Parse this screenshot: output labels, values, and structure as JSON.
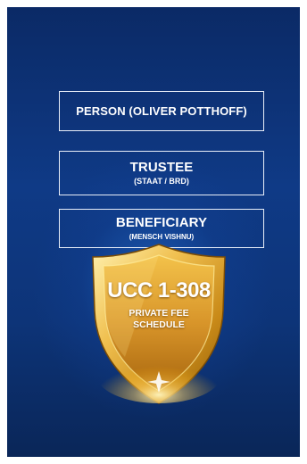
{
  "boxes": {
    "person": {
      "main": "PERSON (OLIVER POTTHOFF)"
    },
    "trustee": {
      "main": "TRUSTEE",
      "sub": "(STAAT / BRD)"
    },
    "beneficiary": {
      "main": "BENEFICIARY",
      "sub": "(MENSCH VISHNU)"
    }
  },
  "shield": {
    "title": "UCC 1-308",
    "line1": "PRIVATE FEE",
    "line2": "SCHEDULE"
  },
  "colors": {
    "background_top": "#0b2a66",
    "background_glow": "#2878dc",
    "gold": "#e2a92c",
    "gold_dark": "#8a5a0a",
    "box_border": "#e8eef8"
  }
}
